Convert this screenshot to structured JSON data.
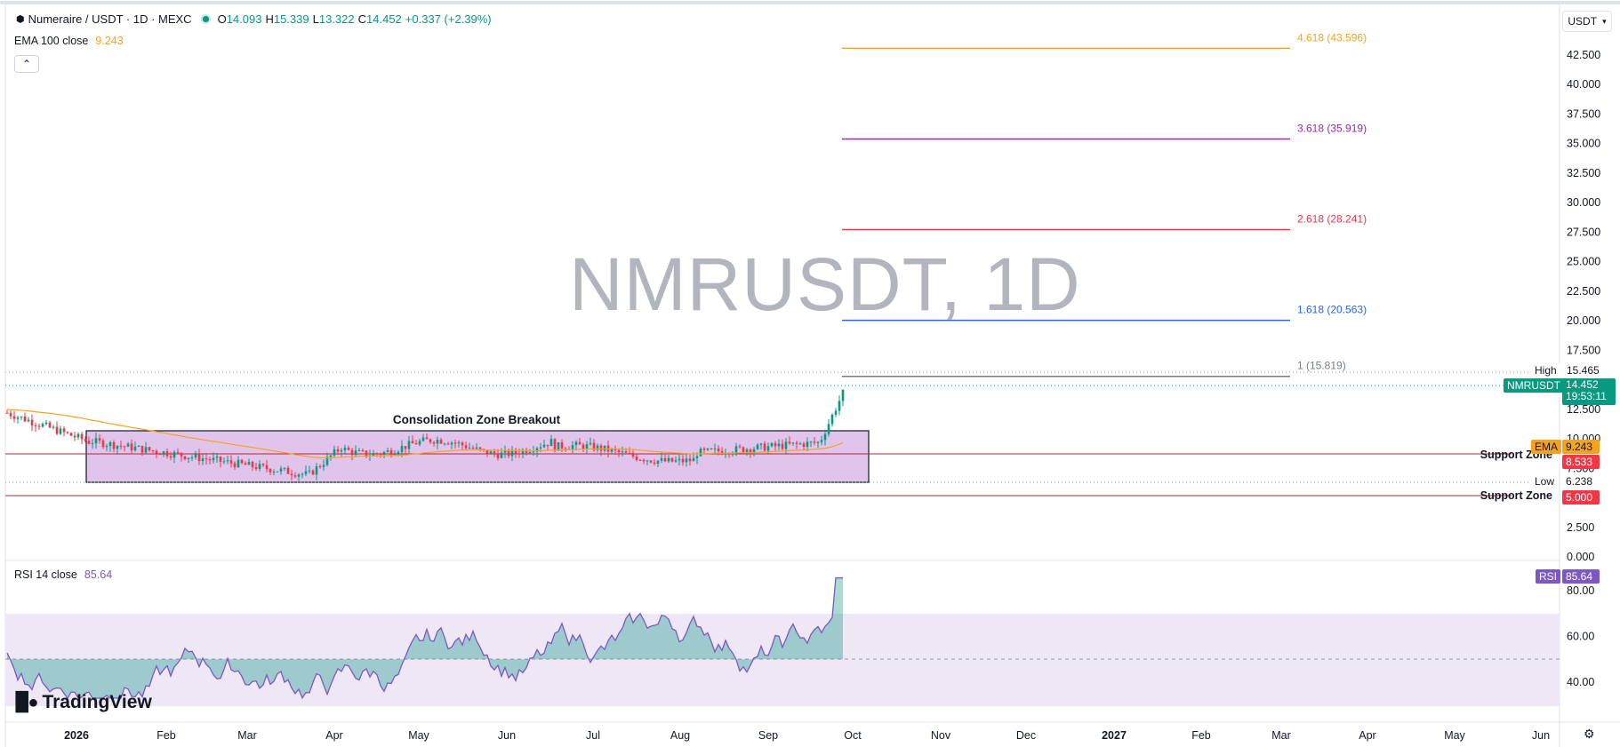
{
  "header": {
    "symbol_title": "Numeraire / USDT · 1D · MEXC",
    "ohlc": {
      "o_label": "O",
      "o_value": "14.093",
      "h_label": "H",
      "h_value": "15.339",
      "l_label": "L",
      "l_value": "13.322",
      "c_label": "C",
      "c_value": "14.452",
      "change": "+0.337 (+2.39%)"
    },
    "ema_label": "EMA 100 close",
    "ema_value": "9.243",
    "currency": "USDT",
    "collapse_icon": "chevron-up-icon"
  },
  "watermark": "NMRUSDT, 1D",
  "annotations": {
    "consolidation_label": "Consolidation Zone Breakout",
    "support_label_1": "Support Zone",
    "support_label_2": "Support Zone",
    "high_label": "High",
    "low_label": "Low"
  },
  "fib_levels": [
    {
      "label": "4.618 (43.596)",
      "value": 43.596,
      "color": "#f7a21b"
    },
    {
      "label": "3.618 (35.919)",
      "value": 35.919,
      "color": "#9c27b0"
    },
    {
      "label": "2.618 (28.241)",
      "value": 28.241,
      "color": "#f23645"
    },
    {
      "label": "1.618 (20.563)",
      "value": 20.563,
      "color": "#2962ff"
    },
    {
      "label": "1 (15.819)",
      "value": 15.819,
      "color": "#787b86"
    }
  ],
  "price_axis": {
    "ticks": [
      "42.500",
      "40.000",
      "37.500",
      "35.000",
      "32.500",
      "30.000",
      "27.500",
      "25.000",
      "22.500",
      "20.000",
      "17.500",
      "12.500",
      "10.000",
      "7.500",
      "2.500",
      "0.000"
    ],
    "tags": {
      "high": "15.465",
      "symbol": "NMRUSDT",
      "last": "14.452",
      "countdown": "19:53:11",
      "ema_name": "EMA",
      "ema": "9.243",
      "support1": "8.533",
      "low": "6.238",
      "support2": "5.000"
    }
  },
  "rsi": {
    "label": "RSI 14 close",
    "value": "85.64",
    "tag_name": "RSI",
    "ticks": [
      "80.00",
      "60.00",
      "40.00"
    ]
  },
  "time_axis": [
    "2026",
    "Feb",
    "Mar",
    "Apr",
    "May",
    "Jun",
    "Jul",
    "Aug",
    "Sep",
    "Oct",
    "Nov",
    "Dec",
    "2027",
    "Feb",
    "Mar",
    "Apr",
    "May",
    "Jun"
  ],
  "branding": {
    "logo_text": "TradingView"
  },
  "colors": {
    "up": "#089981",
    "down": "#f23645",
    "ema": "#f7a21b",
    "rsi_line": "#7e57c2",
    "zone_fill": "#e1c4ec",
    "rsi_band": "#ede7f6"
  }
}
